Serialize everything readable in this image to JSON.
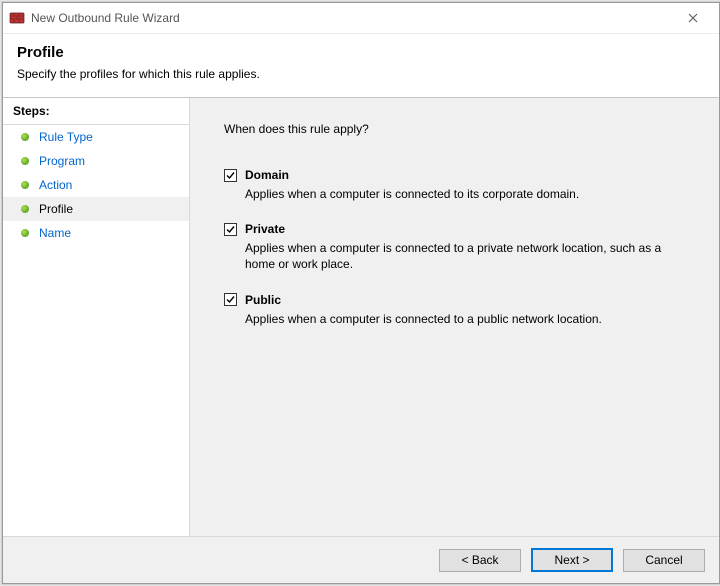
{
  "window": {
    "title": "New Outbound Rule Wizard"
  },
  "header": {
    "title": "Profile",
    "subtitle": "Specify the profiles for which this rule applies."
  },
  "sidebar": {
    "title": "Steps:",
    "items": [
      {
        "label": "Rule Type",
        "current": false
      },
      {
        "label": "Program",
        "current": false
      },
      {
        "label": "Action",
        "current": false
      },
      {
        "label": "Profile",
        "current": true
      },
      {
        "label": "Name",
        "current": false
      }
    ]
  },
  "content": {
    "question": "When does this rule apply?",
    "options": [
      {
        "key": "domain",
        "label": "Domain",
        "checked": true,
        "description": "Applies when a computer is connected to its corporate domain."
      },
      {
        "key": "private",
        "label": "Private",
        "checked": true,
        "description": "Applies when a computer is connected to a private network location, such as a home or work place."
      },
      {
        "key": "public",
        "label": "Public",
        "checked": true,
        "description": "Applies when a computer is connected to a public network location."
      }
    ]
  },
  "footer": {
    "back": "< Back",
    "next": "Next >",
    "cancel": "Cancel"
  }
}
